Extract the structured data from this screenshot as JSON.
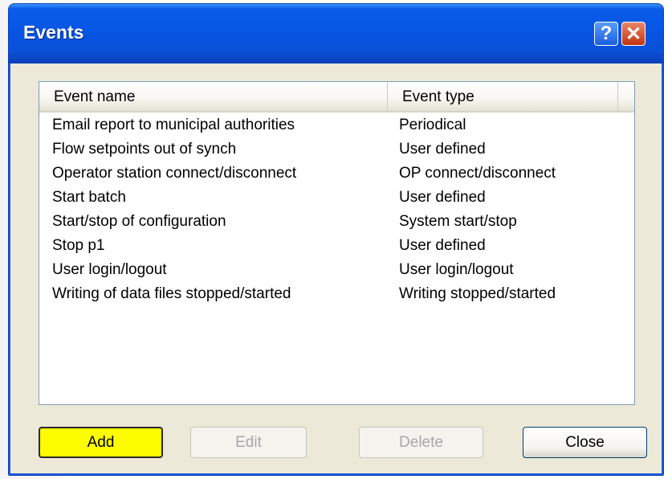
{
  "window": {
    "title": "Events",
    "help_glyph": "?",
    "close_glyph": "✕"
  },
  "list": {
    "columns": [
      {
        "label": "Event name"
      },
      {
        "label": "Event type"
      }
    ],
    "rows": [
      {
        "name": "Email report to municipal authorities",
        "type": "Periodical"
      },
      {
        "name": "Flow setpoints out of synch",
        "type": "User defined"
      },
      {
        "name": "Operator station connect/disconnect",
        "type": "OP connect/disconnect"
      },
      {
        "name": "Start batch",
        "type": "User defined"
      },
      {
        "name": "Start/stop of configuration",
        "type": "System start/stop"
      },
      {
        "name": "Stop p1",
        "type": "User defined"
      },
      {
        "name": "User login/logout",
        "type": "User login/logout"
      },
      {
        "name": "Writing of data files stopped/started",
        "type": "Writing stopped/started"
      }
    ]
  },
  "buttons": {
    "add": "Add",
    "edit": "Edit",
    "delete": "Delete",
    "close": "Close"
  },
  "colors": {
    "add_highlight": "#fdfd00",
    "titlebar": "#0755e4"
  }
}
